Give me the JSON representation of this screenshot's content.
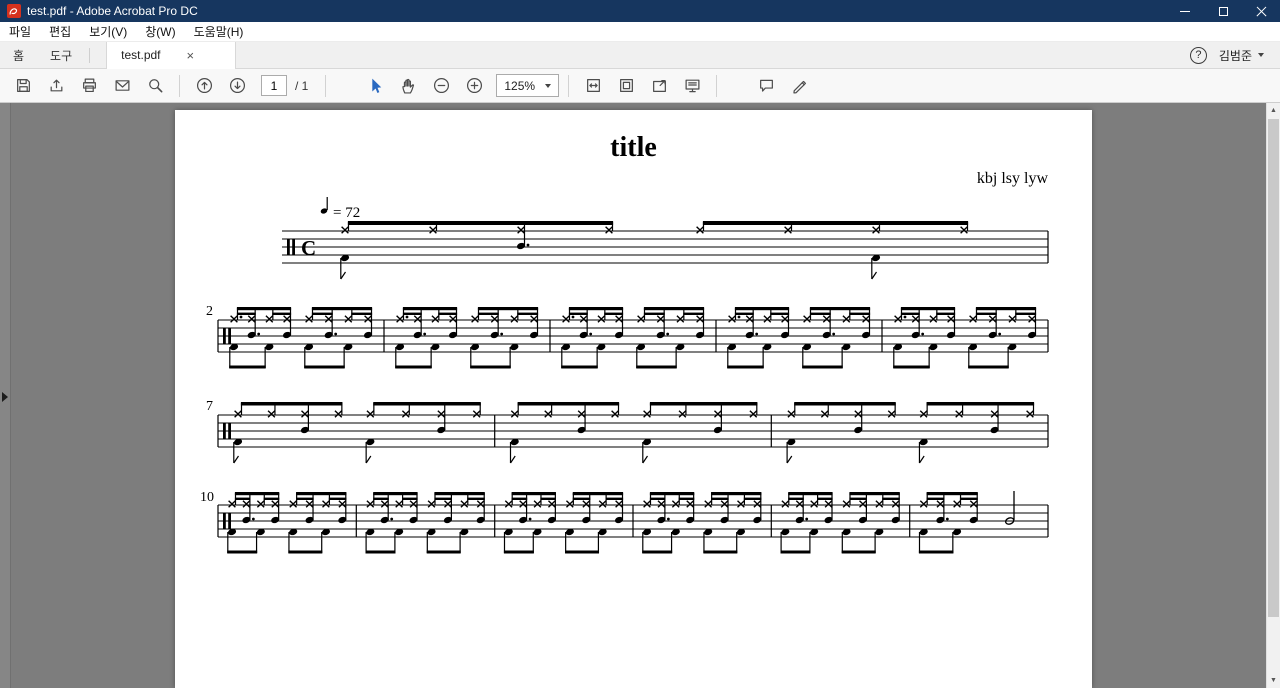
{
  "titlebar": {
    "title": "test.pdf - Adobe Acrobat Pro DC"
  },
  "menubar": {
    "items": [
      "파일",
      "편집",
      "보기(V)",
      "창(W)",
      "도움말(H)"
    ]
  },
  "tabbar": {
    "home": "홈",
    "tools": "도구",
    "document_tab": "test.pdf",
    "close_glyph": "×",
    "help_glyph": "?",
    "user_name": "김범준"
  },
  "toolbar": {
    "page_number": "1",
    "page_total": "/ 1",
    "zoom_level": "125%"
  },
  "scrollbar": {
    "up_glyph": "▲",
    "down_glyph": "▼"
  },
  "score": {
    "title": "title",
    "author": "kbj lsy lyw",
    "tempo": "= 72",
    "time_signature": "C",
    "measure_numbers": [
      "2",
      "7",
      "10"
    ]
  }
}
